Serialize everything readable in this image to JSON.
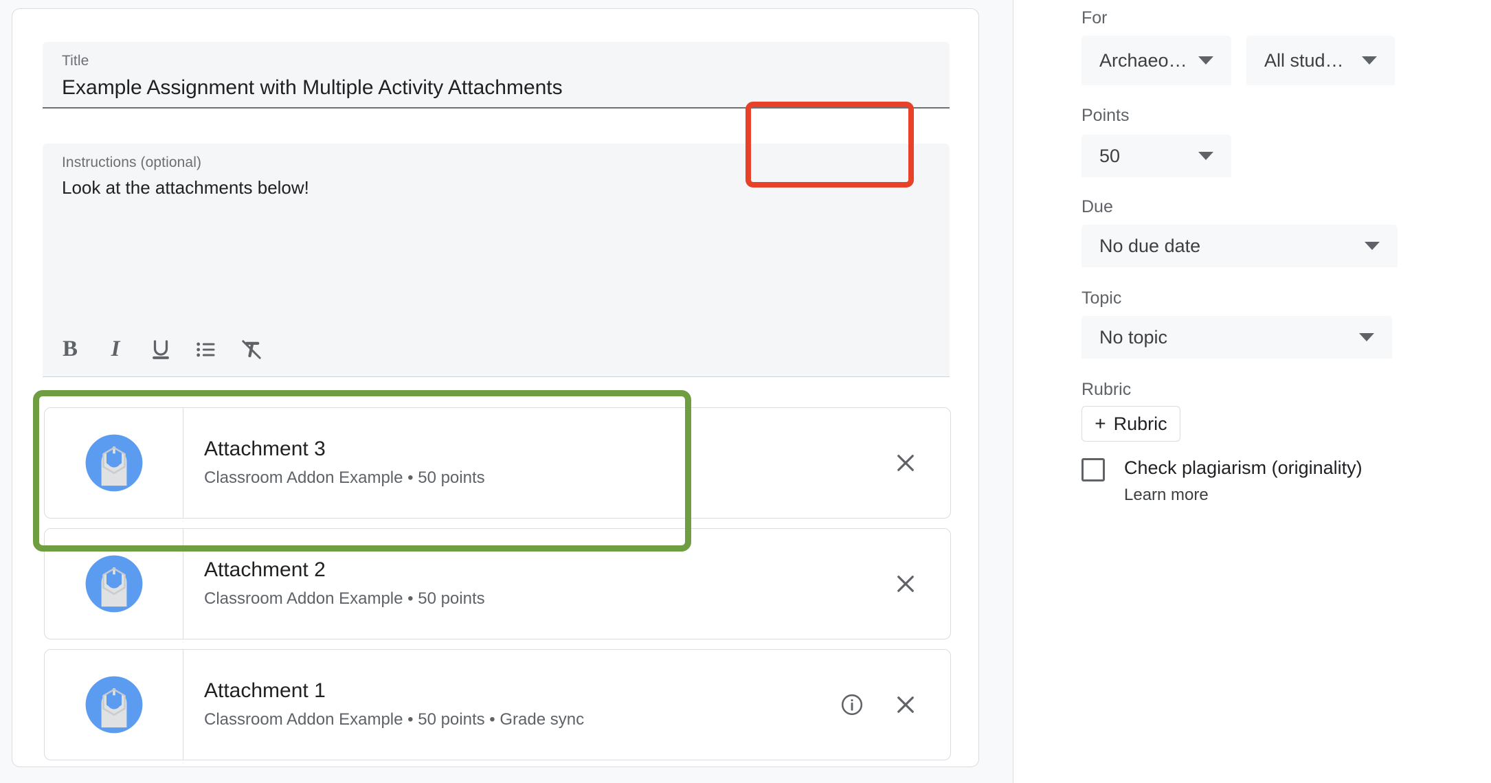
{
  "editor": {
    "title_field": {
      "label": "Title",
      "value": "Example Assignment with Multiple Activity Attachments"
    },
    "instructions_field": {
      "label": "Instructions (optional)",
      "value": "Look at the attachments below!"
    },
    "toolbar": {
      "bold": "B",
      "italic": "I",
      "underline": "U",
      "bulleted_list": "bulleted-list",
      "clear_formatting": "clear-formatting"
    },
    "attachments": [
      {
        "title": "Attachment 3",
        "subtitle": "Classroom Addon Example • 50 points",
        "has_info": false,
        "has_close": true
      },
      {
        "title": "Attachment 2",
        "subtitle": "Classroom Addon Example • 50 points",
        "has_info": false,
        "has_close": true
      },
      {
        "title": "Attachment 1",
        "subtitle": "Classroom Addon Example • 50 points • Grade sync",
        "has_info": true,
        "has_close": true
      }
    ]
  },
  "sidebar": {
    "for": {
      "label": "For",
      "course_value": "Archaeology …",
      "audience_value": "All students"
    },
    "points": {
      "label": "Points",
      "value": "50"
    },
    "due": {
      "label": "Due",
      "value": "No due date"
    },
    "topic": {
      "label": "Topic",
      "value": "No topic"
    },
    "rubric": {
      "label": "Rubric",
      "button_label": "Rubric",
      "plus": "+"
    },
    "plagiarism": {
      "label": "Check plagiarism (originality)",
      "learn_more": "Learn more",
      "checked": false
    }
  },
  "annotations": {
    "points_highlight_color": "#e8412a",
    "attachments_highlight_color": "#6f9d41"
  },
  "theme": {
    "addon_icon_blue": "#5b9cf0",
    "addon_icon_grey": "#dadce0",
    "field_bg": "#f5f6f7",
    "text_primary": "#202124",
    "text_secondary": "#5f6368"
  }
}
